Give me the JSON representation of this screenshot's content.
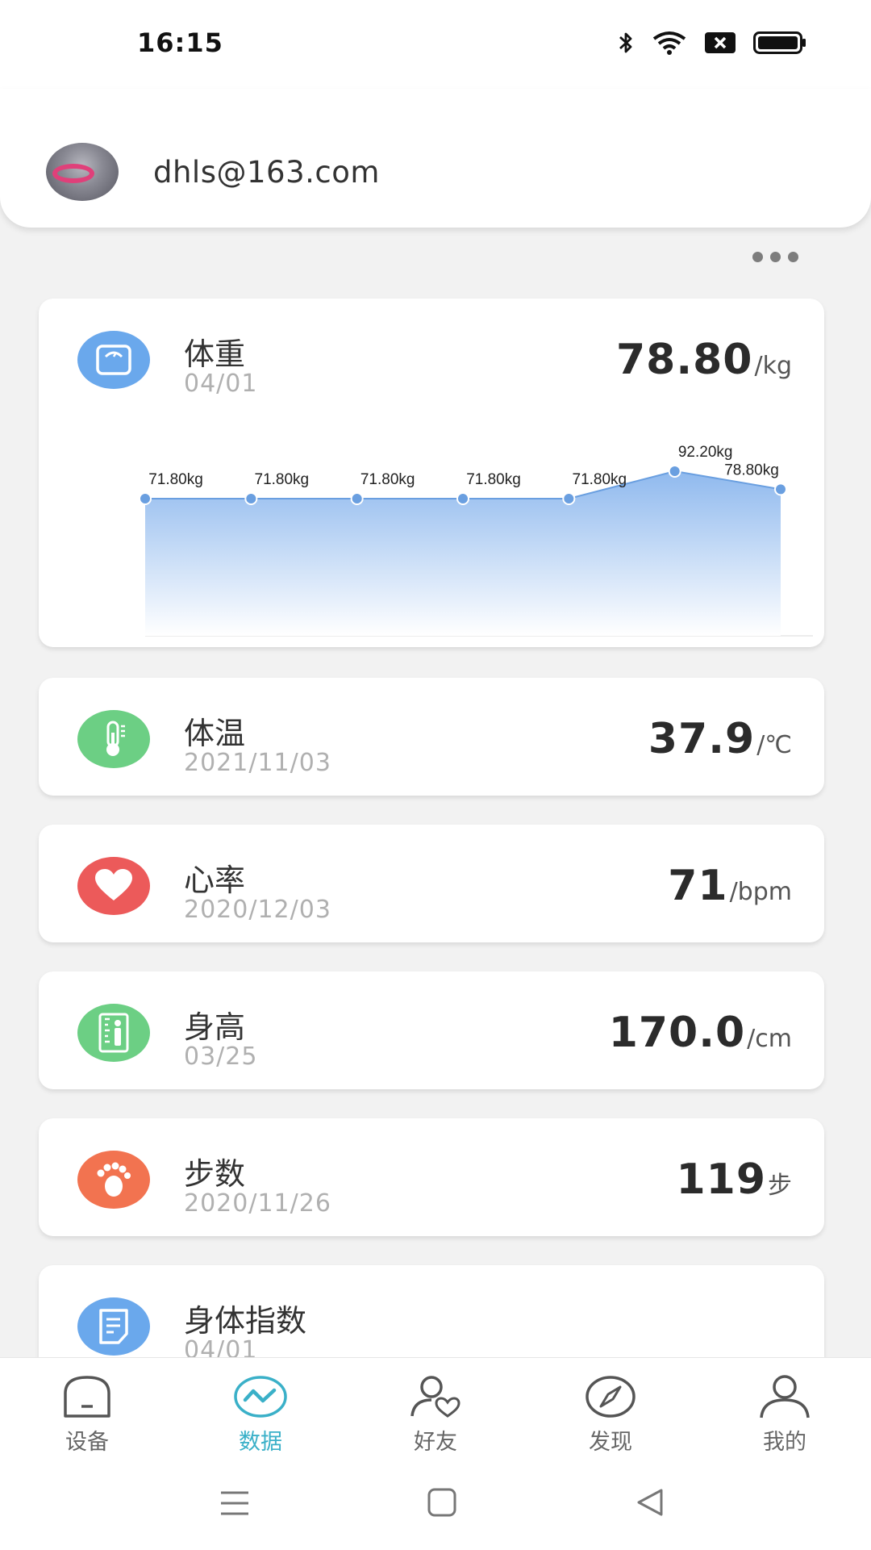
{
  "status": {
    "time": "16:15"
  },
  "header": {
    "account": "dhls@163.com"
  },
  "colors": {
    "accent": "#3ab0c8",
    "blue": "#6aa8ec",
    "green": "#6ccf84",
    "red": "#ec5a5a",
    "orange": "#f27350"
  },
  "weight_card": {
    "title": "体重",
    "date": "04/01",
    "value": "78.80",
    "unit": "/kg",
    "icon": "scale-icon"
  },
  "chart_data": {
    "type": "area",
    "values": [
      71.8,
      71.8,
      71.8,
      71.8,
      71.8,
      92.2,
      78.8
    ],
    "labels": [
      "71.80kg",
      "71.80kg",
      "71.80kg",
      "71.80kg",
      "71.80kg",
      "92.20kg",
      "78.80kg"
    ],
    "title": "",
    "xlabel": "",
    "ylabel": "",
    "grid": false
  },
  "cards": [
    {
      "title": "体温",
      "date": "2021/11/03",
      "value": "37.9",
      "unit": "/℃",
      "icon": "thermometer-icon"
    },
    {
      "title": "心率",
      "date": "2020/12/03",
      "value": "71",
      "unit": "/bpm",
      "icon": "heart-icon"
    },
    {
      "title": "身高",
      "date": "03/25",
      "value": "170.0",
      "unit": "/cm",
      "icon": "height-ruler-icon"
    },
    {
      "title": "步数",
      "date": "2020/11/26",
      "value": "119",
      "unit": "步",
      "icon": "footprint-icon"
    },
    {
      "title": "身体指数",
      "date": "04/01",
      "icon": "document-icon"
    }
  ],
  "nav": [
    {
      "label": "设备",
      "icon": "device-icon"
    },
    {
      "label": "数据",
      "icon": "data-chart-icon",
      "active": true
    },
    {
      "label": "好友",
      "icon": "friends-icon"
    },
    {
      "label": "发现",
      "icon": "compass-icon"
    },
    {
      "label": "我的",
      "icon": "profile-icon"
    }
  ]
}
